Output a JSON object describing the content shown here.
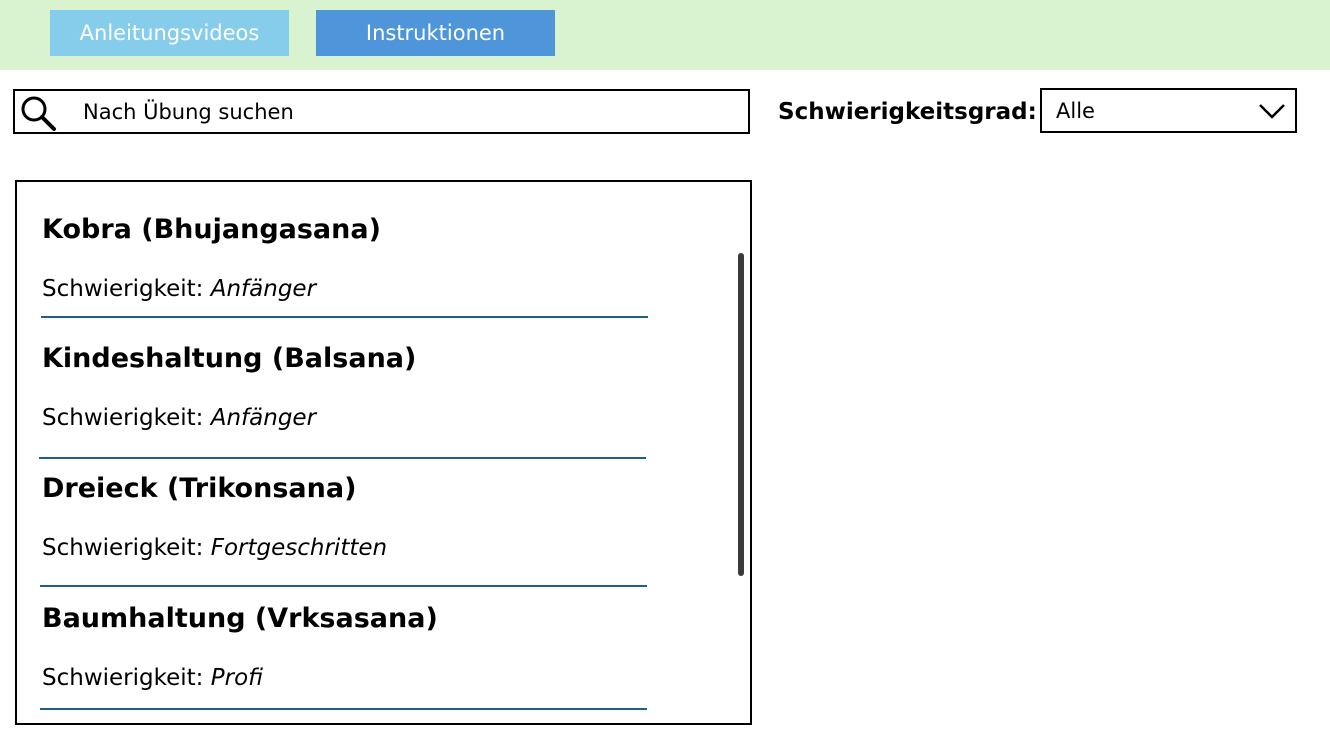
{
  "tabs": [
    {
      "label": "Anleitungsvideos"
    },
    {
      "label": "Instruktionen"
    }
  ],
  "search": {
    "placeholder": "Nach Übung suchen"
  },
  "filter": {
    "label": "Schwierigkeitsgrad:",
    "selected": "Alle"
  },
  "exercises": [
    {
      "title": "Kobra (Bhujangasana)",
      "difficulty_label": "Schwierigkeit:",
      "difficulty": "Anfänger"
    },
    {
      "title": "Kindeshaltung (Balsana)",
      "difficulty_label": "Schwierigkeit:",
      "difficulty": "Anfänger"
    },
    {
      "title": "Dreieck (Trikonsana)",
      "difficulty_label": "Schwierigkeit:",
      "difficulty": "Fortgeschritten"
    },
    {
      "title": "Baumhaltung (Vrksasana)",
      "difficulty_label": "Schwierigkeit:",
      "difficulty": "Profi"
    }
  ],
  "colors": {
    "topbar": "#d9f3d1",
    "tab_videos": "#86cdec",
    "tab_instructions": "#4f95d9",
    "divider": "#1f5f8b"
  },
  "icons": {
    "search": "search-icon",
    "dropdown": "chevron-down-icon"
  }
}
